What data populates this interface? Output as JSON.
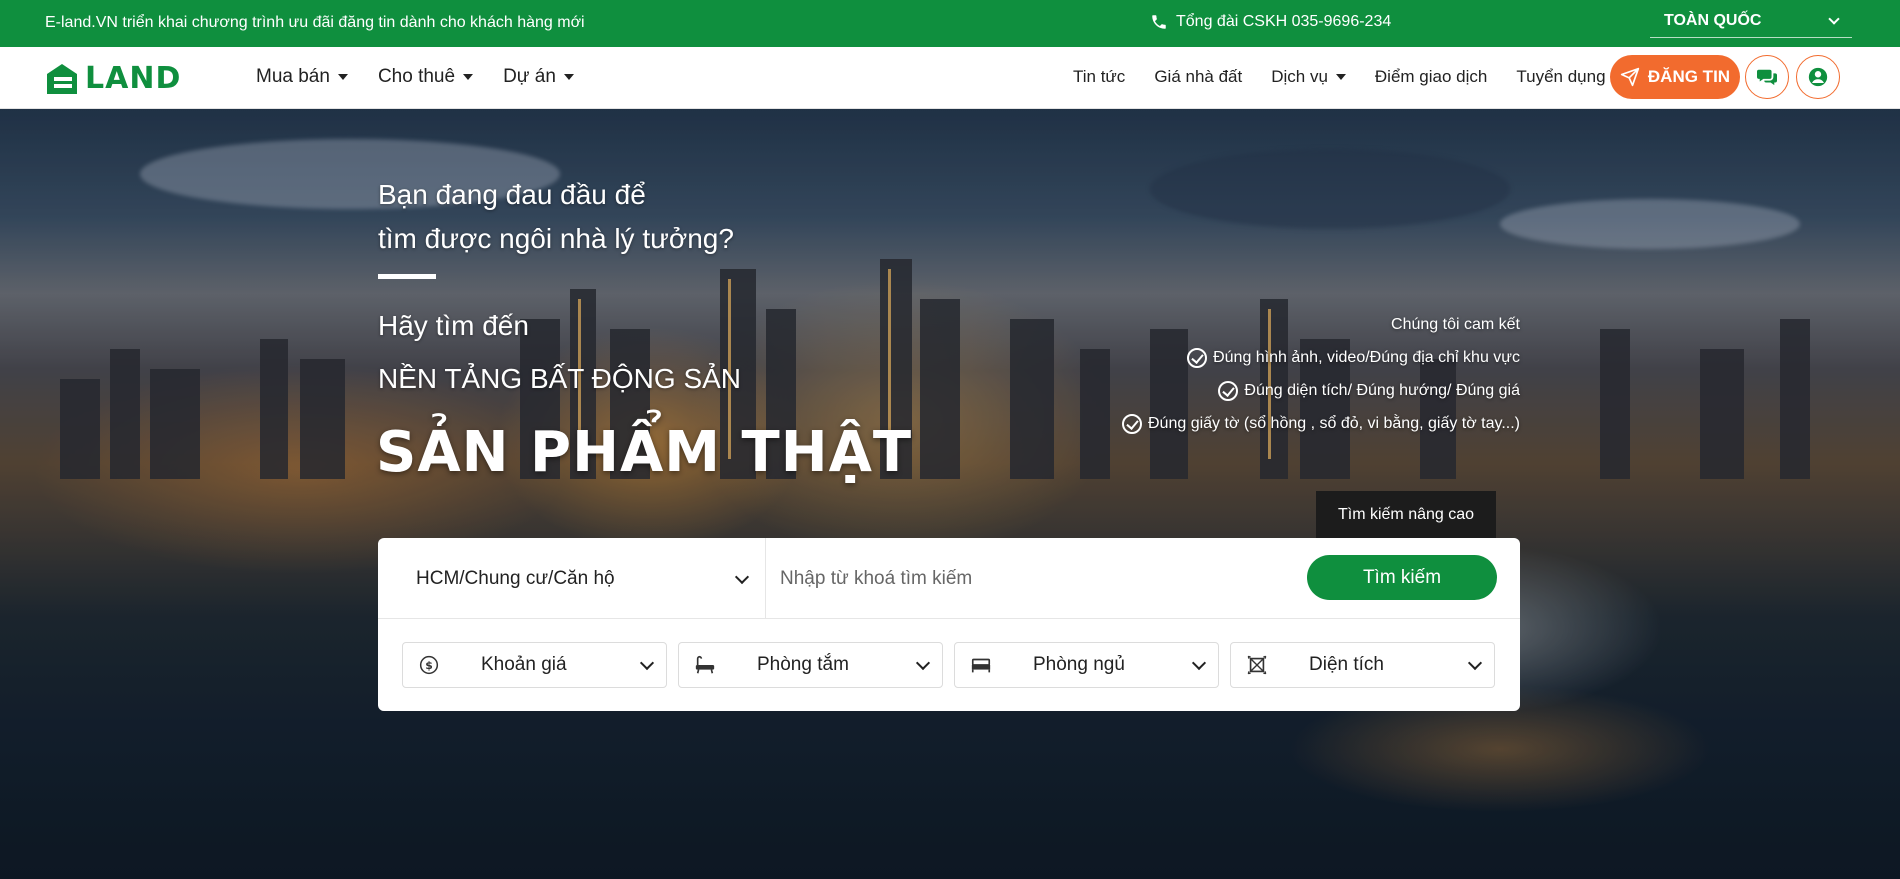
{
  "topbar": {
    "promo": "E-land.VN triển khai chương trình ưu đãi đăng tin dành cho khách hàng mới",
    "hotline": "Tổng đài CSKH 035-9696-234",
    "region": "TOÀN QUỐC"
  },
  "nav": {
    "logo_text": "LAND",
    "left_items": [
      {
        "label": "Mua bán"
      },
      {
        "label": "Cho thuê"
      },
      {
        "label": "Dự án"
      }
    ],
    "right_items": [
      {
        "label": "Tin tức"
      },
      {
        "label": "Giá nhà đất"
      },
      {
        "label": "Dịch vụ"
      },
      {
        "label": "Điểm giao dịch"
      },
      {
        "label": "Tuyển dụng"
      }
    ],
    "post_button": "ĐĂNG TIN"
  },
  "hero": {
    "tagline_line1": "Bạn đang đau đầu để",
    "tagline_line2": "tìm được ngôi nhà lý tưởng?",
    "invite": "Hãy tìm đến",
    "platform": "NỀN TẢNG BẤT ĐỘNG SẢN",
    "product": "SẢN PHẨM THẬT",
    "commitment": {
      "title": "Chúng tôi cam kết",
      "items": [
        "Đúng hình ảnh, video/Đúng địa chỉ khu vực",
        "Đúng diện tích/ Đúng hướng/ Đúng giá",
        "Đúng giấy tờ (sổ hồng , sổ đỏ, vi bằng, giấy tờ tay...)"
      ]
    }
  },
  "search": {
    "advanced_tab": "Tìm kiếm nâng cao",
    "category": "HCM/Chung cư/Căn hộ",
    "keyword_placeholder": "Nhập từ khoá tìm kiếm",
    "button": "Tìm kiếm",
    "filters": [
      {
        "label": "Khoản giá",
        "icon": "dollar-icon"
      },
      {
        "label": "Phòng tắm",
        "icon": "bathtub-icon"
      },
      {
        "label": "Phòng ngủ",
        "icon": "bed-icon"
      },
      {
        "label": "Diện tích",
        "icon": "area-icon"
      }
    ]
  },
  "colors": {
    "brand_green": "#0f8f3e",
    "accent_orange": "#f26b2e",
    "dark_tab": "#1c1c1c"
  }
}
